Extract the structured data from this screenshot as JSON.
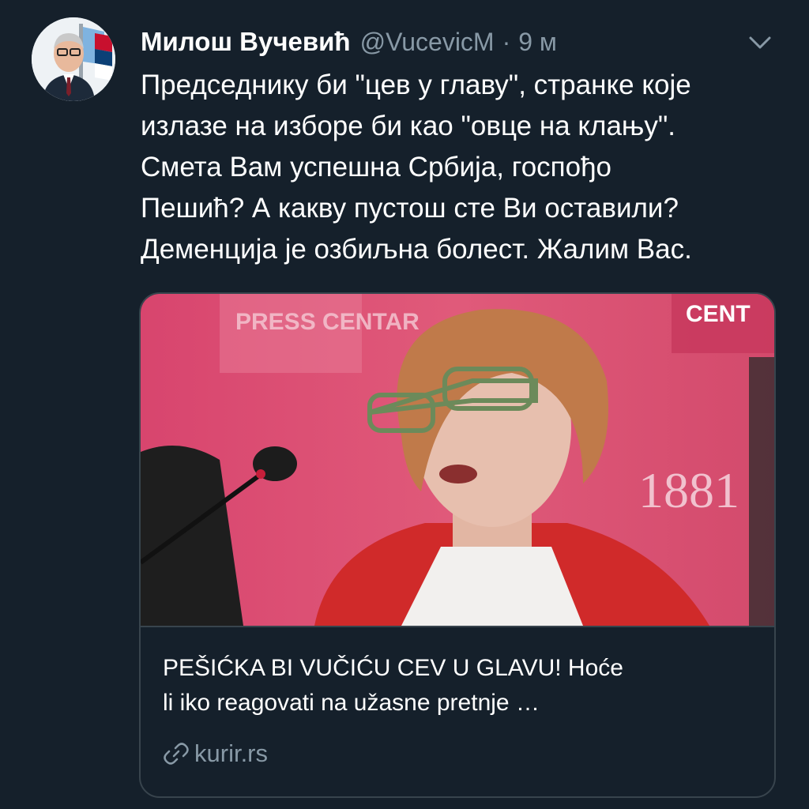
{
  "tweet": {
    "author": {
      "display_name": "Милош Вучевић",
      "handle": "@VucevicM",
      "separator": "·",
      "time": "9 м"
    },
    "text_lines": [
      "Председнику би \"цев у главу\", странке које",
      "излазе на изборе би као \"овце на клању\".",
      "Смета Вам успешна Србија, госпођо",
      "Пешић? А какву пустош сте Ви оставили?",
      "Деменција је озбиљна болест. Жалим Вас."
    ],
    "card": {
      "title_lines": [
        "PEŠIĆKA BI VUČIĆU CEV U GLAVU! Hoće",
        "li iko reagovati na užasne pretnje …"
      ],
      "domain": "kurir.rs",
      "image_sign_text": "PRESS CENTAR",
      "image_sign_text_right": "CENT",
      "image_year_text": "1881"
    }
  },
  "colors": {
    "background": "#15202b",
    "primary_text": "#ffffff",
    "secondary_text": "#8899a6",
    "border": "#38444d",
    "image_backdrop": "#d8446a",
    "jacket": "#d42a2a"
  },
  "icons": {
    "caret": "chevron-down-icon",
    "link": "link-icon"
  }
}
